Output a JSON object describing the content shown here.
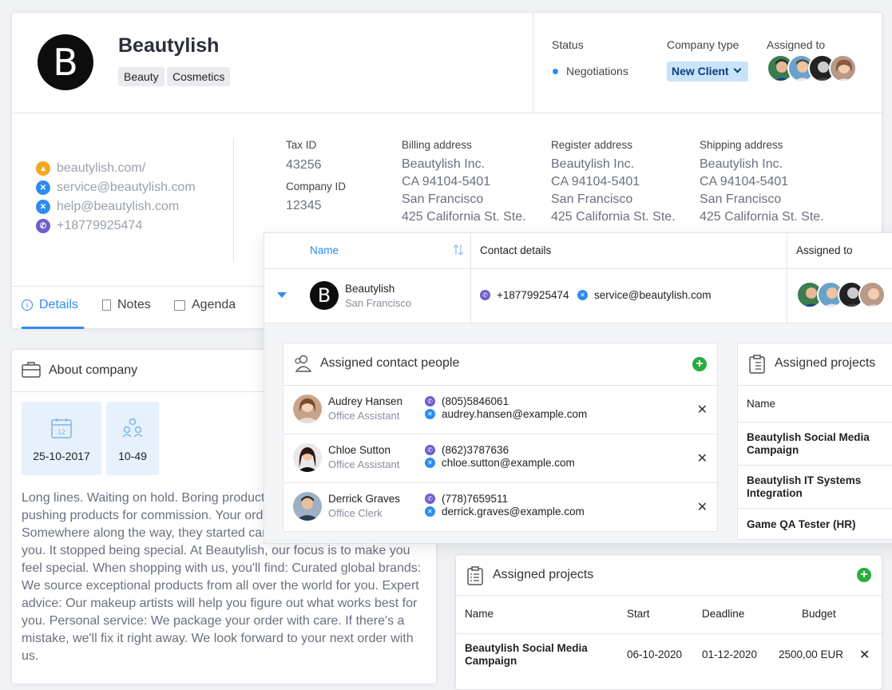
{
  "company": {
    "logo_letter": "B",
    "name": "Beautylish",
    "tags": [
      "Beauty",
      "Cosmetics"
    ],
    "status_label": "Status",
    "status_value": "Negotiations",
    "company_type_label": "Company type",
    "company_type_value": "New Client",
    "assigned_to_label": "Assigned to"
  },
  "contacts": {
    "website": "beautylish.com/",
    "email1": "service@beautylish.com",
    "email2": "help@beautylish.com",
    "phone": "+18779925474"
  },
  "info": {
    "tax_id_label": "Tax ID",
    "tax_id": "43256",
    "company_id_label": "Company ID",
    "company_id": "12345",
    "billing_label": "Billing address",
    "register_label": "Register address",
    "shipping_label": "Shipping address",
    "address_lines": [
      "Beautylish Inc.",
      "CA 94104-5401",
      "San Francisco",
      "425 California St. Ste."
    ]
  },
  "tabs": [
    "Details",
    "Notes",
    "Agenda"
  ],
  "about": {
    "title": "About company",
    "date": "25-10-2017",
    "size": "10-49",
    "text": "Long lines. Waiting on hold. Boring products. Complicated order. Clerks pushing products for commission. Your order thrown into a box. Somewhere along the way, they started caring more about them than you. It stopped being special. At Beautylish, our focus is to make you feel special. When shopping with us, you'll find: Curated global brands: We source exceptional products from all over the world for you.  Expert advice: Our makeup artists will help you figure out what works best for you. Personal service: We package your order with care. If there's a mistake, we'll fix it right away.  We look forward to your next order with us."
  },
  "projects_bottom": {
    "title": "Assigned projects",
    "headers": [
      "Name",
      "Start",
      "Deadline",
      "Budget"
    ],
    "rows": [
      {
        "name": "Beautylish Social Media Campaign",
        "start": "06-10-2020",
        "deadline": "01-12-2020",
        "budget": "2500,00 EUR"
      }
    ]
  },
  "overlay": {
    "col_name": "Name",
    "col_contact": "Contact details",
    "col_assigned": "Assigned to",
    "row_name": "Beautylish",
    "row_city": "San Francisco",
    "row_phone": "+18779925474",
    "row_email": "service@beautylish.com",
    "contact_people_title": "Assigned contact people",
    "people": [
      {
        "name": "Audrey Hansen",
        "role": "Office Assistant",
        "phone": "(805)5846061",
        "email": "audrey.hansen@example.com"
      },
      {
        "name": "Chloe Sutton",
        "role": "Office Assistant",
        "phone": "(862)3787636",
        "email": "chloe.sutton@example.com"
      },
      {
        "name": "Derrick Graves",
        "role": "Office Clerk",
        "phone": "(778)7659511",
        "email": "derrick.graves@example.com"
      }
    ],
    "projects_title": "Assigned projects",
    "projects_header": "Name",
    "projects": [
      "Beautylish Social Media Campaign",
      "Beautylish IT Systems Integration",
      "Game QA Tester (HR)"
    ]
  },
  "colors": {
    "accent": "#2e8cf0",
    "add": "#27ae3c",
    "viber": "#6f5ccd",
    "email": "#2e8cf0",
    "web": "#f2a81d"
  }
}
